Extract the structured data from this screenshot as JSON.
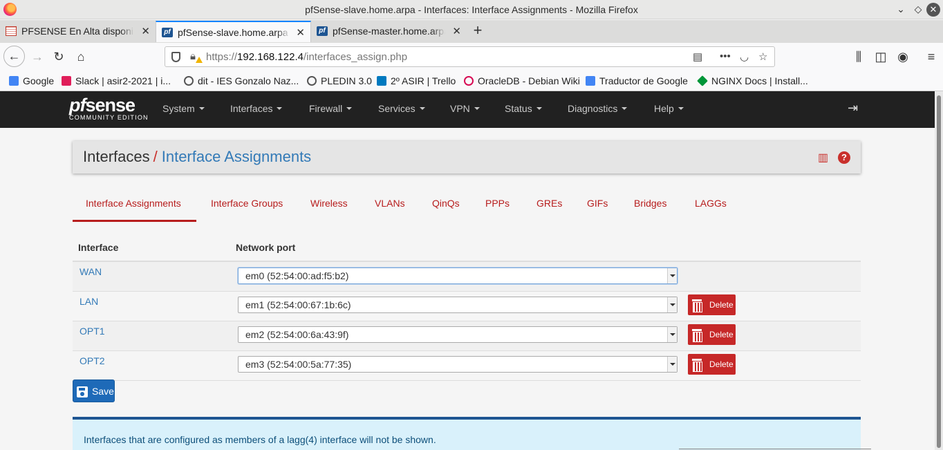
{
  "window": {
    "title": "pfSense-slave.home.arpa - Interfaces: Interface Assignments - Mozilla Firefox",
    "controls": [
      "⌄",
      "◇",
      "✕"
    ]
  },
  "browser_tabs": [
    {
      "label": "PFSENSE En Alta disponibilidad",
      "icon": "document-icon",
      "active": false
    },
    {
      "label": "pfSense-slave.home.arpa",
      "icon": "pfsense-favicon",
      "active": true
    },
    {
      "label": "pfSense-master.home.arpa",
      "icon": "pfsense-favicon",
      "active": false
    }
  ],
  "new_tab_label": "+",
  "address_bar": {
    "scheme": "https://",
    "host": "192.168.122.4",
    "path": "/interfaces_assign.php"
  },
  "bookmarks": [
    {
      "label": "Google",
      "icon_color": "#4285f4"
    },
    {
      "label": "Slack | asir2-2021 | i...",
      "icon_color": "#e01e5a"
    },
    {
      "label": "dit - IES Gonzalo Naz...",
      "icon_color": "#555555"
    },
    {
      "label": "PLEDIN 3.0",
      "icon_color": "#555555"
    },
    {
      "label": "2º ASIR | Trello",
      "icon_color": "#0079bf"
    },
    {
      "label": "OracleDB - Debian Wiki",
      "icon_color": "#d70a53"
    },
    {
      "label": "Traductor de Google",
      "icon_color": "#4285f4"
    },
    {
      "label": "NGINX Docs | Install...",
      "icon_color": "#009639"
    }
  ],
  "pfsense": {
    "logo_main_italic": "pf",
    "logo_main_rest": "sense",
    "logo_sub": "COMMUNITY EDITION",
    "menu": [
      "System",
      "Interfaces",
      "Firewall",
      "Services",
      "VPN",
      "Status",
      "Diagnostics",
      "Help"
    ]
  },
  "breadcrumb": {
    "parent": "Interfaces",
    "separator": "/",
    "current": "Interface Assignments"
  },
  "subtabs": [
    "Interface Assignments",
    "Interface Groups",
    "Wireless",
    "VLANs",
    "QinQs",
    "PPPs",
    "GREs",
    "GIFs",
    "Bridges",
    "LAGGs"
  ],
  "table": {
    "headers": [
      "Interface",
      "Network port"
    ],
    "rows": [
      {
        "interface": "WAN",
        "port": "em0 (52:54:00:ad:f5:b2)",
        "deletable": false
      },
      {
        "interface": "LAN",
        "port": "em1 (52:54:00:67:1b:6c)",
        "deletable": true
      },
      {
        "interface": "OPT1",
        "port": "em2 (52:54:00:6a:43:9f)",
        "deletable": true
      },
      {
        "interface": "OPT2",
        "port": "em3 (52:54:00:5a:77:35)",
        "deletable": true
      }
    ],
    "delete_label": "Delete"
  },
  "save_label": "Save",
  "info_message": "Interfaces that are configured as members of a lagg(4) interface will not be shown.",
  "colors": {
    "accent_red": "#b71c1c",
    "link_blue": "#337ab7",
    "save_blue": "#1e6ab8",
    "navbar_dark": "#212121"
  }
}
